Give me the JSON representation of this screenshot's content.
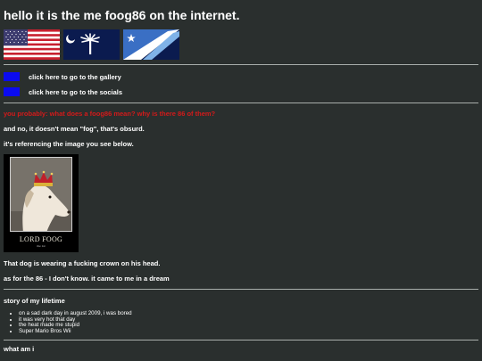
{
  "title": "hello it is the me foog86 on the internet.",
  "links": [
    {
      "label": "click here to go to the gallery"
    },
    {
      "label": "click here to go to the socials"
    }
  ],
  "question": "you probably: what does a foog86 mean? why is there 86 of them?",
  "answer1": "and no, it doesn't mean \"fog\", that's obsurd.",
  "answer2": "it's referencing the image you see below.",
  "poster": {
    "caption": "LORD FOOG",
    "subcaption": "the 1st"
  },
  "dog_text": "That dog is wearing a fucking crown on his head.",
  "eighty_six_text": "as for the 86 - I don't know. it came to me in a dream",
  "story_title": "story of my lifetime",
  "story_items": [
    "on a sad dark day in august 2009, i was bored",
    "it was very hot that day",
    "the heat made me stupid",
    "Super Mario Bros Wii"
  ],
  "next_section": "what am i",
  "colors": {
    "background": "#2a2f2e",
    "question": "#d41a1a",
    "link_swatch": "#0b0bf0",
    "divider": "#a8aeab"
  }
}
